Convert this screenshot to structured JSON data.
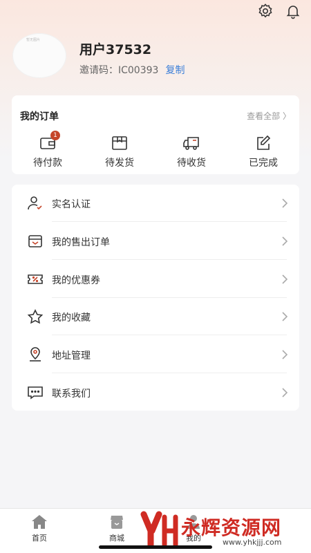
{
  "header": {
    "icons": [
      "gear-icon",
      "bell-icon"
    ]
  },
  "profile": {
    "avatar_text": "暂无图片",
    "username": "用户37532",
    "invite_label": "邀请码：IC00393",
    "copy_label": "复制"
  },
  "orders": {
    "title": "我的订单",
    "view_all": "查看全部 〉",
    "items": [
      {
        "label": "待付款",
        "icon": "wallet-icon",
        "badge": "1"
      },
      {
        "label": "待发货",
        "icon": "box-icon"
      },
      {
        "label": "待收货",
        "icon": "truck-icon"
      },
      {
        "label": "已完成",
        "icon": "edit-icon"
      }
    ]
  },
  "menu": {
    "items": [
      {
        "label": "实名认证",
        "icon": "user-verify-icon"
      },
      {
        "label": "我的售出订单",
        "icon": "sold-order-icon"
      },
      {
        "label": "我的优惠券",
        "icon": "coupon-icon"
      },
      {
        "label": "我的收藏",
        "icon": "star-icon"
      },
      {
        "label": "地址管理",
        "icon": "location-icon"
      },
      {
        "label": "联系我们",
        "icon": "message-icon"
      }
    ]
  },
  "tabbar": {
    "tabs": [
      {
        "label": "首页",
        "icon": "home-icon"
      },
      {
        "label": "商城",
        "icon": "shop-icon"
      },
      {
        "label": "我的"
      }
    ]
  },
  "watermark": {
    "text": "永辉资源网",
    "url": "www.yhkjjj.com"
  },
  "colors": {
    "accent": "#3a7ed8",
    "badge": "#c5452a",
    "watermark": "#cf2b23"
  }
}
